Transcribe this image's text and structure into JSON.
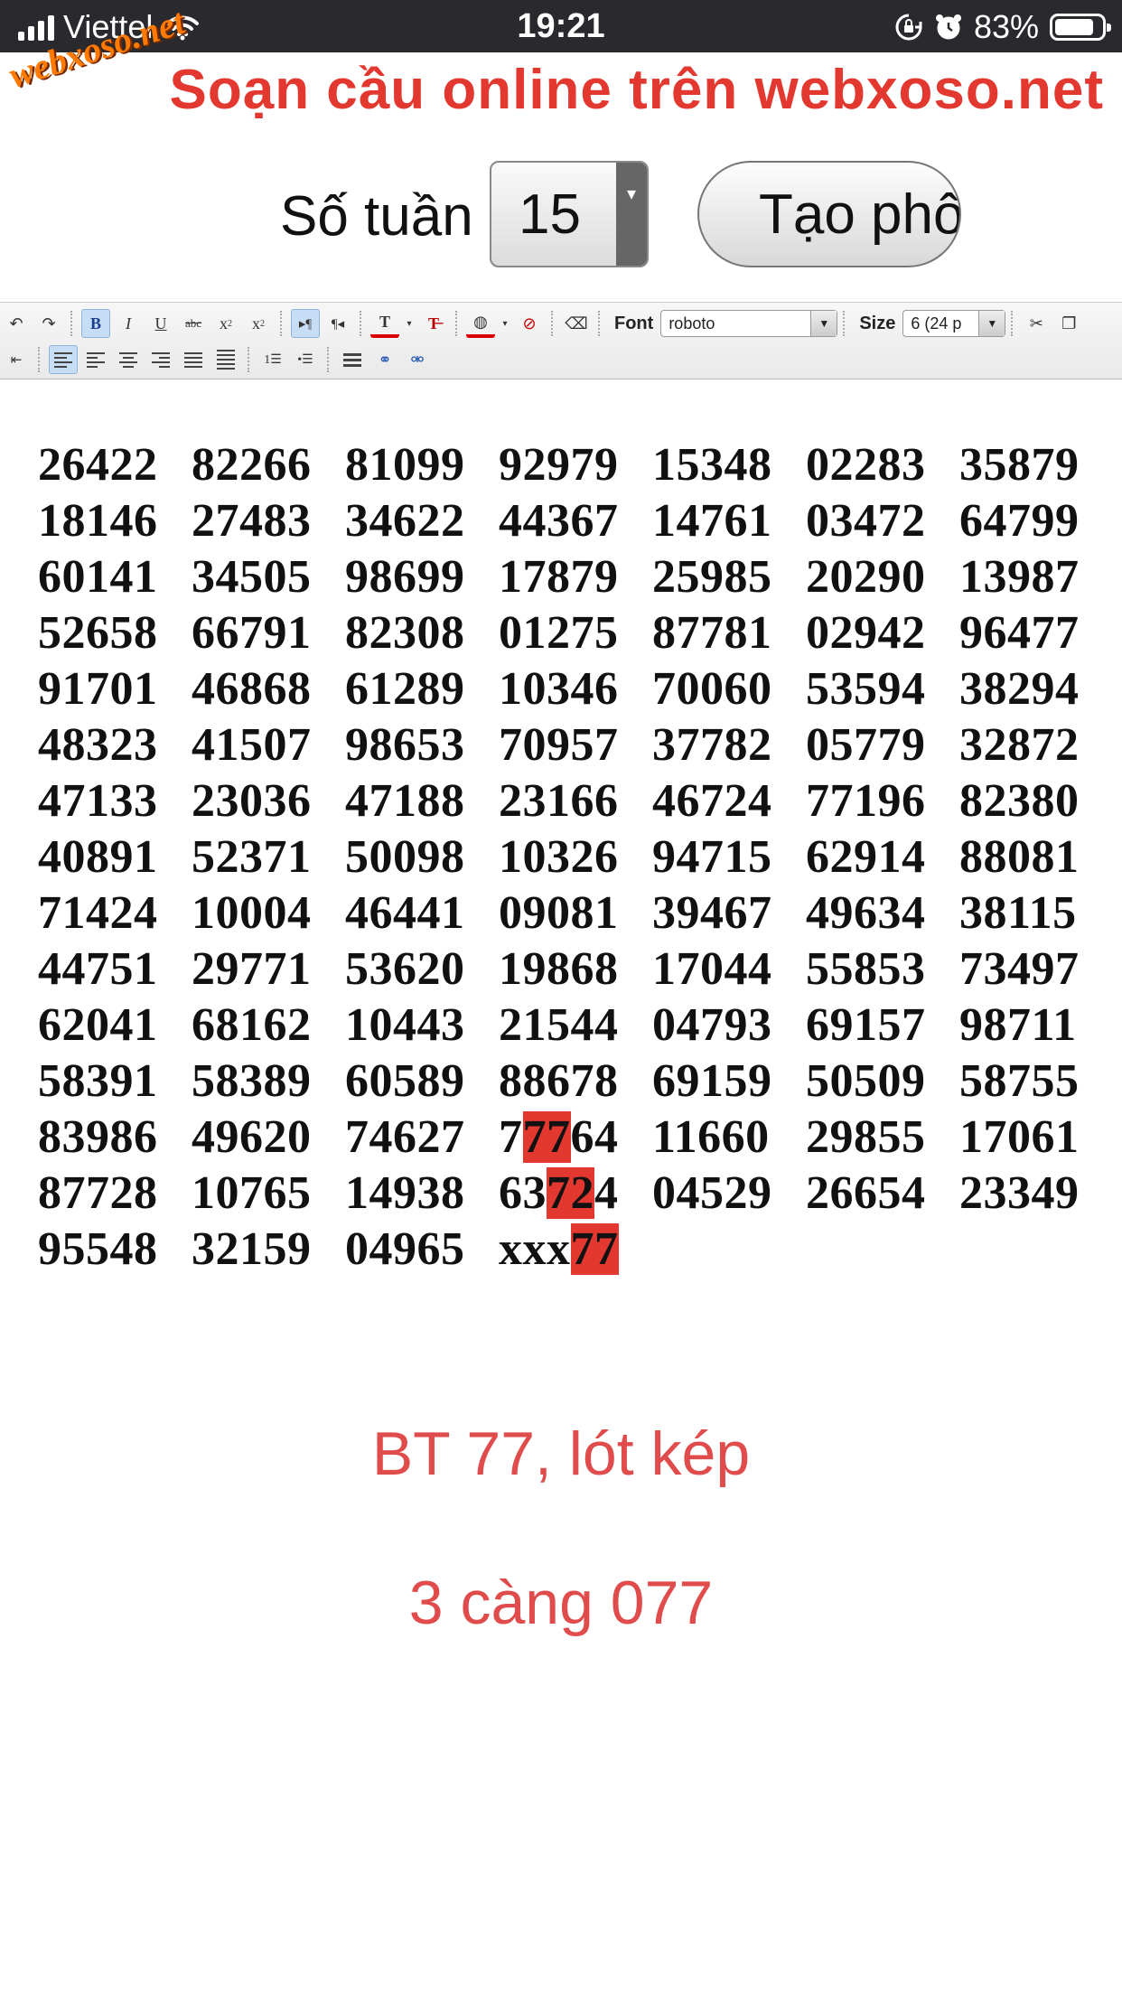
{
  "status_bar": {
    "carrier": "Viettel",
    "time": "19:21",
    "battery": "83%",
    "battery_level": 0.83
  },
  "watermark": "webxoso.net",
  "title": "Soạn cầu online trên webxoso.net",
  "controls": {
    "weeks_label": "Số tuần",
    "weeks_value": "15",
    "create_button": "Tạo phôi"
  },
  "toolbar": {
    "font_label": "Font",
    "font_value": "roboto",
    "size_label": "Size",
    "size_value": "6 (24 p"
  },
  "grid": {
    "rows": [
      [
        [
          "26422"
        ],
        [
          "82266"
        ],
        [
          "81099"
        ],
        [
          "92979"
        ],
        [
          "15348"
        ],
        [
          "02283"
        ],
        [
          "35879"
        ]
      ],
      [
        [
          "18146"
        ],
        [
          "27483"
        ],
        [
          "34622"
        ],
        [
          "44367"
        ],
        [
          "14761"
        ],
        [
          "03472"
        ],
        [
          "64799"
        ]
      ],
      [
        [
          "60141"
        ],
        [
          "34505"
        ],
        [
          "98699"
        ],
        [
          "17879"
        ],
        [
          "25985"
        ],
        [
          "20290"
        ],
        [
          "13987"
        ]
      ],
      [
        [
          "52658"
        ],
        [
          "66791"
        ],
        [
          "82308"
        ],
        [
          "01275"
        ],
        [
          "87781"
        ],
        [
          "02942"
        ],
        [
          "96477"
        ]
      ],
      [
        [
          "91701"
        ],
        [
          "46868"
        ],
        [
          "61289"
        ],
        [
          "10346"
        ],
        [
          "70060"
        ],
        [
          "53594"
        ],
        [
          "38294"
        ]
      ],
      [
        [
          "48323"
        ],
        [
          "41507"
        ],
        [
          "98653"
        ],
        [
          "70957"
        ],
        [
          "37782"
        ],
        [
          "05779"
        ],
        [
          "32872"
        ]
      ],
      [
        [
          "47133"
        ],
        [
          "23036"
        ],
        [
          "47188"
        ],
        [
          "23166"
        ],
        [
          "46724"
        ],
        [
          "77196"
        ],
        [
          "82380"
        ]
      ],
      [
        [
          "40891"
        ],
        [
          "52371"
        ],
        [
          "50098"
        ],
        [
          "10326"
        ],
        [
          "94715"
        ],
        [
          "62914"
        ],
        [
          "88081"
        ]
      ],
      [
        [
          "71424"
        ],
        [
          "10004"
        ],
        [
          "46441"
        ],
        [
          "09081"
        ],
        [
          "39467"
        ],
        [
          "49634"
        ],
        [
          "38115"
        ]
      ],
      [
        [
          "44751"
        ],
        [
          "29771"
        ],
        [
          "53620"
        ],
        [
          "19868"
        ],
        [
          "17044"
        ],
        [
          "55853"
        ],
        [
          "73497"
        ]
      ],
      [
        [
          "62041"
        ],
        [
          "68162"
        ],
        [
          "10443"
        ],
        [
          "21544"
        ],
        [
          "04793"
        ],
        [
          "69157"
        ],
        [
          "98711"
        ]
      ],
      [
        [
          "58391"
        ],
        [
          "58389"
        ],
        [
          "60589"
        ],
        [
          "88678"
        ],
        [
          "69159"
        ],
        [
          "50509"
        ],
        [
          "58755"
        ]
      ],
      [
        [
          "83986"
        ],
        [
          "49620"
        ],
        [
          "74627"
        ],
        [
          "7",
          "77",
          "64"
        ],
        [
          "11660"
        ],
        [
          "29855"
        ],
        [
          "17061"
        ]
      ],
      [
        [
          "87728"
        ],
        [
          "10765"
        ],
        [
          "14938"
        ],
        [
          "63",
          "72",
          "4"
        ],
        [
          "04529"
        ],
        [
          "26654"
        ],
        [
          "23349"
        ]
      ],
      [
        [
          "95548"
        ],
        [
          "32159"
        ],
        [
          "04965"
        ],
        [
          "xxx",
          "77",
          ""
        ]
      ]
    ]
  },
  "notes": [
    "BT 77, lót kép",
    "3 càng 077"
  ]
}
